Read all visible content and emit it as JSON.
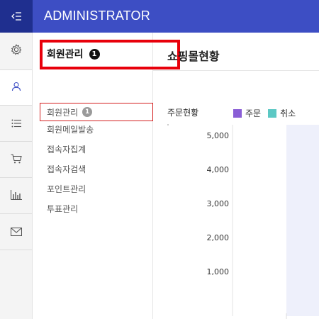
{
  "header": {
    "brand": "ADMINISTRATOR",
    "menu_icon": "sidebar-collapse-icon"
  },
  "rail": {
    "items": [
      {
        "icon": "gear-icon",
        "active": false
      },
      {
        "icon": "user-icon",
        "active": true
      },
      {
        "icon": "list-icon",
        "active": false
      },
      {
        "icon": "cart-icon",
        "active": false
      },
      {
        "icon": "bar-chart-icon",
        "active": false
      },
      {
        "icon": "mail-icon",
        "active": false
      }
    ]
  },
  "panel": {
    "title": "회원관리",
    "title_badge": "1",
    "items": [
      {
        "label": "회원관리",
        "badge": "1"
      },
      {
        "label": "회원메일발송"
      },
      {
        "label": "접속자집계"
      },
      {
        "label": "접속자검색"
      },
      {
        "label": "포인트관리"
      },
      {
        "label": "투표관리"
      }
    ]
  },
  "main": {
    "title": "쇼핑몰현황"
  },
  "chart_data": {
    "type": "bar",
    "title": "주문현황",
    "series": [
      {
        "name": "주문",
        "color": "#8a5ed6",
        "values": []
      },
      {
        "name": "취소",
        "color": "#5cc8c4",
        "values": []
      }
    ],
    "yticks": [
      "5,000",
      "4,000",
      "3,000",
      "2,000",
      "1,000"
    ],
    "ylim": [
      0,
      5000
    ],
    "highlight_color": "#eef0fb"
  }
}
